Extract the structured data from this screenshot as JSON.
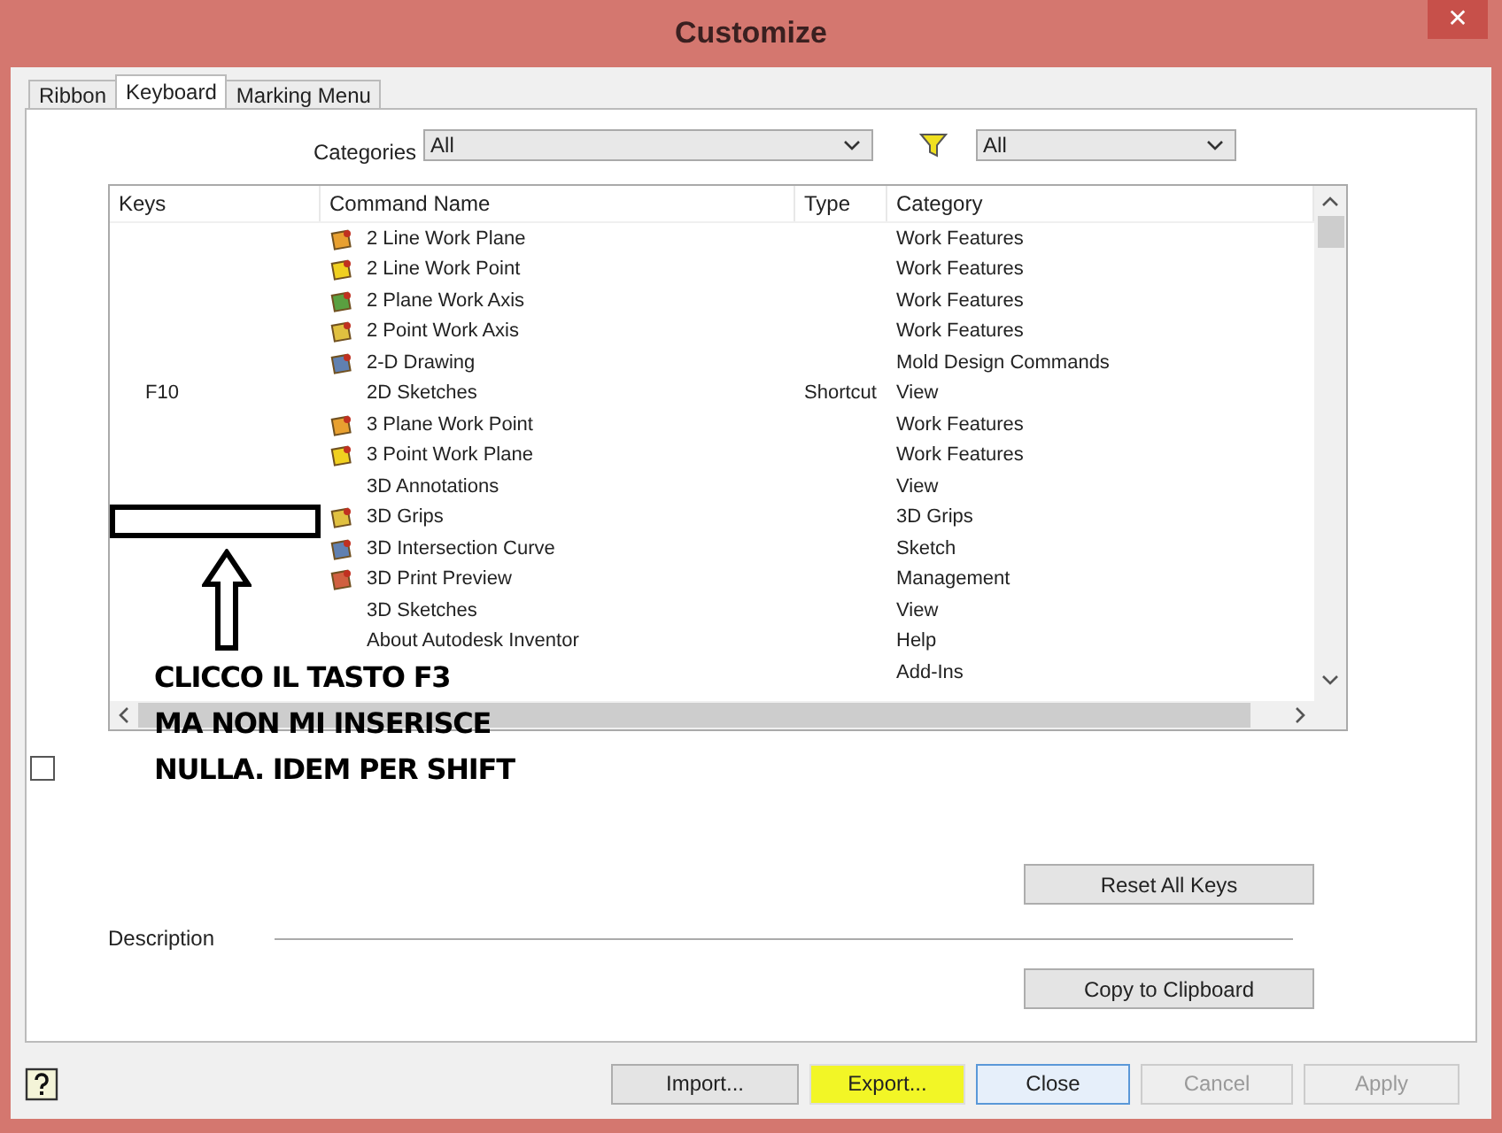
{
  "window": {
    "title": "Customize",
    "close": "✕"
  },
  "tabs": [
    {
      "label": "Ribbon",
      "selected": false
    },
    {
      "label": "Keyboard",
      "selected": true
    },
    {
      "label": "Marking Menu",
      "selected": false
    }
  ],
  "filters": {
    "categories_label": "Categories",
    "categories_value": "All",
    "type_value": "All"
  },
  "table": {
    "columns": [
      "Keys",
      "Command Name",
      "Type",
      "Category"
    ],
    "rows": [
      {
        "keys": "",
        "command": "2 Line Work Plane",
        "type": "",
        "category": "Work Features",
        "has_icon": true
      },
      {
        "keys": "",
        "command": "2 Line Work Point",
        "type": "",
        "category": "Work Features",
        "has_icon": true
      },
      {
        "keys": "",
        "command": "2 Plane Work Axis",
        "type": "",
        "category": "Work Features",
        "has_icon": true
      },
      {
        "keys": "",
        "command": "2 Point Work Axis",
        "type": "",
        "category": "Work Features",
        "has_icon": true
      },
      {
        "keys": "",
        "command": "2-D Drawing",
        "type": "",
        "category": "Mold Design Commands",
        "has_icon": true
      },
      {
        "keys": "F10",
        "command": "2D Sketches",
        "type": "Shortcut",
        "category": "View",
        "has_icon": false
      },
      {
        "keys": "",
        "command": "3 Plane Work Point",
        "type": "",
        "category": "Work Features",
        "has_icon": true
      },
      {
        "keys": "",
        "command": "3 Point Work Plane",
        "type": "",
        "category": "Work Features",
        "has_icon": true
      },
      {
        "keys": "",
        "command": "3D Annotations",
        "type": "",
        "category": "View",
        "has_icon": false
      },
      {
        "keys": "",
        "command": "3D Grips",
        "type": "",
        "category": "3D Grips",
        "has_icon": true
      },
      {
        "keys": "",
        "command": "3D Intersection Curve",
        "type": "",
        "category": "Sketch",
        "has_icon": true
      },
      {
        "keys": "",
        "command": "3D Print Preview",
        "type": "",
        "category": "Management",
        "has_icon": true
      },
      {
        "keys": "",
        "command": "3D Sketches",
        "type": "",
        "category": "View",
        "has_icon": false
      },
      {
        "keys": "",
        "command": "About Autodesk Inventor",
        "type": "",
        "category": "Help",
        "has_icon": false
      },
      {
        "keys": "",
        "command": "",
        "type": "",
        "category": "Add-Ins",
        "has_icon": false
      }
    ]
  },
  "checkbox": {
    "checked": false
  },
  "reset_button": "Reset All Keys",
  "description_label": "Description",
  "copy_button": "Copy to Clipboard",
  "footer_buttons": [
    {
      "label": "Import...",
      "disabled": false,
      "focused": false,
      "highlighted": false
    },
    {
      "label": "Export...",
      "disabled": false,
      "focused": false,
      "highlighted": true
    },
    {
      "label": "Close",
      "disabled": false,
      "focused": true,
      "highlighted": false
    },
    {
      "label": "Cancel",
      "disabled": true,
      "focused": false,
      "highlighted": false
    },
    {
      "label": "Apply",
      "disabled": true,
      "focused": false,
      "highlighted": false
    }
  ],
  "annotation": {
    "lines": [
      "CLICCO IL TASTO F3",
      "MA NON MI INSERISCE",
      "NULLA. IDEM PER SHIFT"
    ]
  }
}
